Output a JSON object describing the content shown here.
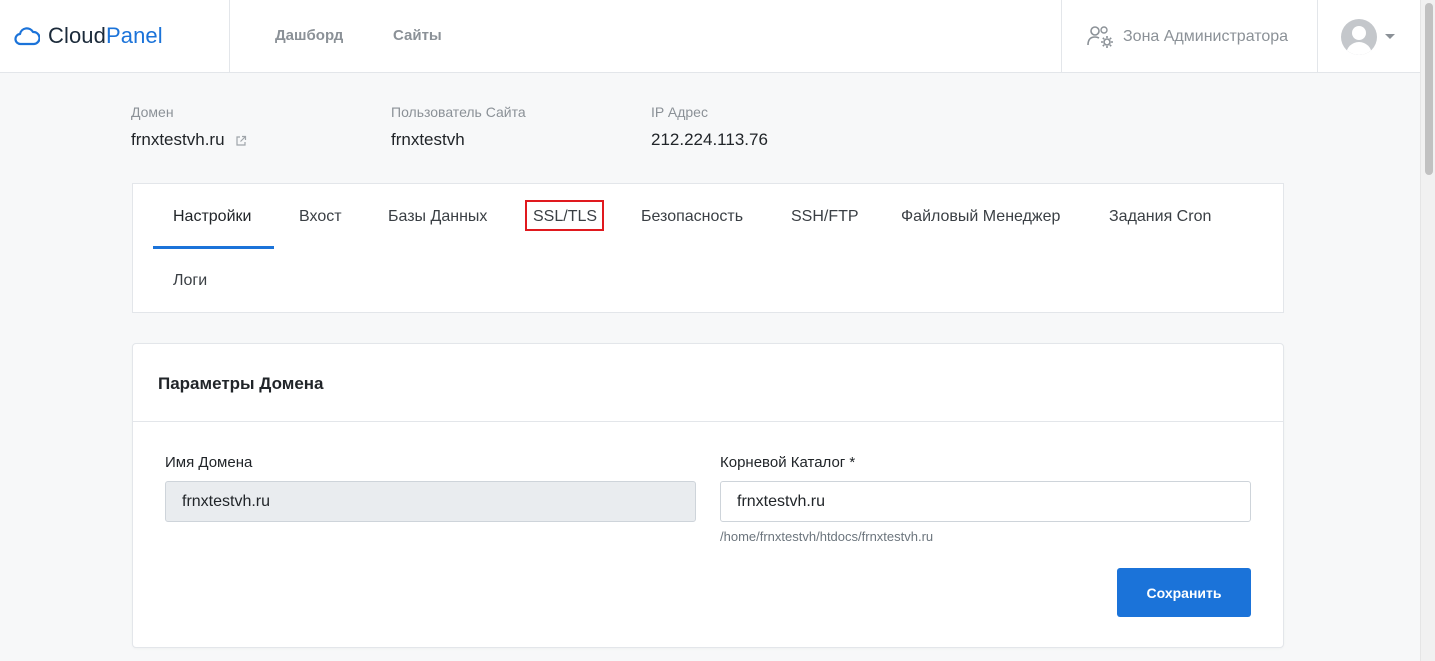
{
  "brand": {
    "cloud": "Cloud",
    "panel": "Panel"
  },
  "nav": {
    "dashboard": "Дашборд",
    "sites": "Сайты",
    "admin_zone": "Зона Администратора"
  },
  "info": {
    "domain_label": "Домен",
    "domain_value": "frnxtestvh.ru",
    "user_label": "Пользователь Сайта",
    "user_value": "frnxtestvh",
    "ip_label": "IP Адрес",
    "ip_value": "212.224.113.76"
  },
  "tabs": [
    {
      "label": "Настройки"
    },
    {
      "label": "Вхост"
    },
    {
      "label": "Базы Данных"
    },
    {
      "label": "SSL/TLS"
    },
    {
      "label": "Безопасность"
    },
    {
      "label": "SSH/FTP"
    },
    {
      "label": "Файловый Менеджер"
    },
    {
      "label": "Задания Cron"
    },
    {
      "label": "Логи"
    }
  ],
  "settings": {
    "title": "Параметры Домена",
    "domain_name_label": "Имя Домена",
    "domain_name_value": "frnxtestvh.ru",
    "root_dir_label": "Корневой Каталог *",
    "root_dir_value": "frnxtestvh.ru",
    "root_dir_help": "/home/frnxtestvh/htdocs/frnxtestvh.ru",
    "save_label": "Сохранить"
  },
  "colors": {
    "accent": "#1b73d9",
    "highlight": "#e0191e"
  }
}
